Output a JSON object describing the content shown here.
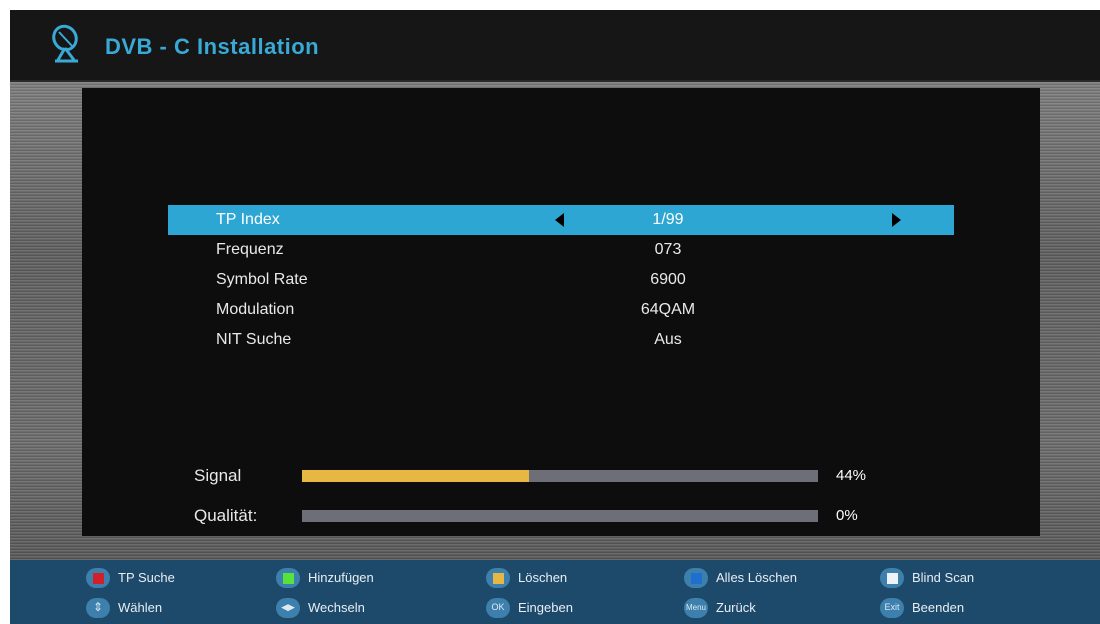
{
  "header": {
    "title": "DVB - C Installation",
    "icon": "satellite-dish-icon"
  },
  "settings": [
    {
      "label": "TP Index",
      "value": "1/99",
      "selected": true
    },
    {
      "label": "Frequenz",
      "value": "073"
    },
    {
      "label": "Symbol Rate",
      "value": "6900"
    },
    {
      "label": "Modulation",
      "value": "64QAM"
    },
    {
      "label": "NIT Suche",
      "value": "Aus"
    }
  ],
  "meters": {
    "signal": {
      "label": "Signal",
      "percent_text": "44%",
      "level": 0.44
    },
    "quality": {
      "label": "Qualität:",
      "percent_text": "0%",
      "level": 0.0
    }
  },
  "colors": {
    "selection": "#2ea6d4",
    "title": "#39a9d6",
    "signal_fill": "#e6b843",
    "footer_bg": "#1d4a6a"
  },
  "footer": {
    "row1": [
      {
        "key": "red-key-icon",
        "color": "#d1202a",
        "label": "TP Suche"
      },
      {
        "key": "green-key-icon",
        "color": "#56e33b",
        "label": "Hinzufügen"
      },
      {
        "key": "yellow-key-icon",
        "color": "#e6b843",
        "label": "Löschen"
      },
      {
        "key": "blue-key-icon",
        "color": "#1f6fd0",
        "label": "Alles Löschen"
      },
      {
        "key": "white-key-icon",
        "color": "#eef3f7",
        "label": "Blind Scan"
      }
    ],
    "row2": [
      {
        "key": "updown-arrow-icon",
        "icon_text": "⇕",
        "label": "Wählen"
      },
      {
        "key": "leftright-arrow-icon",
        "icon_text": "◀▶",
        "label": "Wechseln"
      },
      {
        "key": "ok-key-icon",
        "icon_text": "OK",
        "label": "Eingeben"
      },
      {
        "key": "menu-key-icon",
        "icon_text": "Menu",
        "label": "Zurück"
      },
      {
        "key": "exit-key-icon",
        "icon_text": "Exit",
        "label": "Beenden"
      }
    ]
  }
}
